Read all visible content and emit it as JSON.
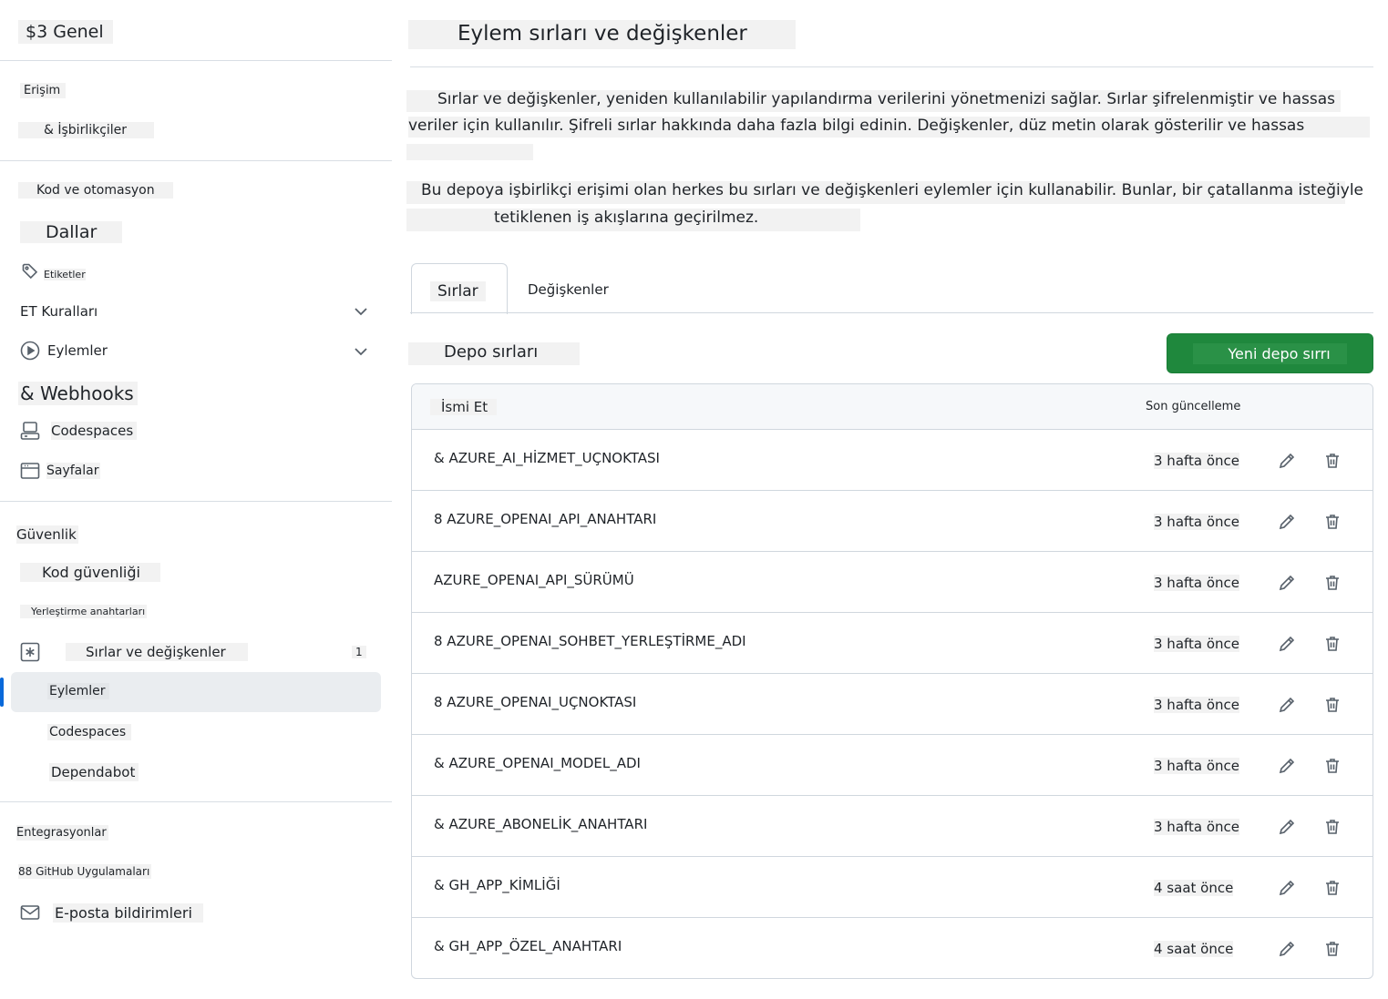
{
  "sidebar": {
    "title": "$3 Genel",
    "access_heading": "Erişim",
    "collaborators": "& İşbirlikçiler",
    "code_heading": "Kod ve otomasyon",
    "branches": "Dallar",
    "tags": "Etiketler",
    "rules": "ET Kuralları",
    "actions": "Eylemler",
    "webhooks": "& Webhooks",
    "codespaces": "Codespaces",
    "pages": "Sayfalar",
    "security_heading": "Güvenlik",
    "code_security": "Kod güvenliği",
    "deploy_keys": "Yerleştirme anahtarları",
    "secrets_vars": "Sırlar ve değişkenler",
    "secrets_count": "1",
    "sub_actions": "Eylemler",
    "sub_codespaces": "Codespaces",
    "sub_dependabot": "Dependabot",
    "integrations_heading": "Entegrasyonlar",
    "github_apps": "88 GitHub Uygulamaları",
    "email_notifications": "E-posta bildirimleri"
  },
  "main": {
    "title": "Eylem sırları ve değişkenler",
    "para1_line1": "Sırlar ve değişkenler, yeniden kullanılabilir yapılandırma verilerini yönetmenizi sağlar. Sırlar şifrelenmiştir ve hassas",
    "para1_line2": "veriler için kullanılır. Şifreli sırlar hakkında daha fazla bilgi edinin. Değişkenler, düz metin olarak gösterilir ve hassas",
    "para2_line1": "Bu depoya işbirlikçi erişimi olan herkes bu sırları ve değişkenleri eylemler için kullanabilir. Bunlar, bir çatallanma isteğiyle",
    "para2_line2": "tetiklenen iş akışlarına geçirilmez.",
    "tab_secrets": "Sırlar",
    "tab_variables": "Değişkenler",
    "section_title": "Depo sırları",
    "new_secret_button": "Yeni depo sırrı",
    "table": {
      "col_name": "İsmi Et",
      "col_updated": "Son güncelleme",
      "rows": [
        {
          "name": "& AZURE_AI_HİZMET_UÇNOKTASI",
          "updated": "3 hafta önce"
        },
        {
          "name": "8  AZURE_OPENAI_API_ANAHTARI",
          "updated": "3 hafta önce"
        },
        {
          "name": "AZURE_OPENAI_API_SÜRÜMÜ",
          "updated": "3 hafta önce"
        },
        {
          "name": "8  AZURE_OPENAI_SOHBET_YERLEŞTİRME_ADI",
          "updated": "3 hafta önce"
        },
        {
          "name": "8  AZURE_OPENAI_UÇNOKTASI",
          "updated": "3 hafta önce"
        },
        {
          "name": "& AZURE_OPENAI_MODEL_ADI",
          "updated": "3 hafta önce"
        },
        {
          "name": "& AZURE_ABONELİK_ANAHTARI",
          "updated": "3 hafta önce"
        },
        {
          "name": "& GH_APP_KİMLİĞİ",
          "updated": "4 saat önce"
        },
        {
          "name": "& GH_APP_ÖZEL_ANAHTARI",
          "updated": "4 saat önce"
        }
      ]
    }
  },
  "colors": {
    "accent_green": "#1f883d",
    "active_indicator": "#0969da",
    "border": "#d0d7de"
  },
  "icons": {
    "tags": "tag-icon",
    "actions": "play-icon",
    "codespaces": "codespaces-icon",
    "pages": "browser-icon",
    "secrets": "asterisk-icon",
    "email": "mail-icon",
    "edit": "pencil-icon",
    "delete": "trash-icon"
  }
}
